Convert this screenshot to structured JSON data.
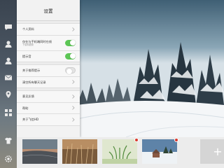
{
  "panel": {
    "title": "设置",
    "rows": [
      {
        "label": "个人资料",
        "sub": "",
        "control": "chevron"
      },
      {
        "label": "仅在与手机端同时在线",
        "sub": "下载和更新",
        "control": "toggle",
        "on": true
      },
      {
        "label": "提示音",
        "sub": "",
        "control": "toggle",
        "on": true
      },
      {
        "label": "关于推荐提示",
        "sub": "",
        "control": "toggle",
        "on": false
      },
      {
        "label": "清空所有聊天记录",
        "sub": "",
        "control": "chevron"
      },
      {
        "label": "意见反馈",
        "sub": "",
        "control": "chevron"
      },
      {
        "label": "帮助",
        "sub": "",
        "control": "chevron"
      },
      {
        "label": "关于飞信HD",
        "sub": "",
        "control": "chevron"
      }
    ]
  },
  "strip_icons": [
    "chat-icon",
    "contact-icon",
    "contact-icon",
    "message-icon",
    "group-icon",
    "location-icon",
    "grid-icon",
    "shirt-icon",
    "gear-icon"
  ],
  "thumbnails": [
    {
      "name": "lake-sunset-thumb",
      "has_delete": false
    },
    {
      "name": "reeds-thumb",
      "has_delete": false
    },
    {
      "name": "green-plant-thumb",
      "has_delete": true
    },
    {
      "name": "snow-house-thumb",
      "has_delete": true
    }
  ],
  "add_label": "+",
  "colors": {
    "toggle_on": "#5cc655",
    "delete_badge": "#d83a2f"
  }
}
